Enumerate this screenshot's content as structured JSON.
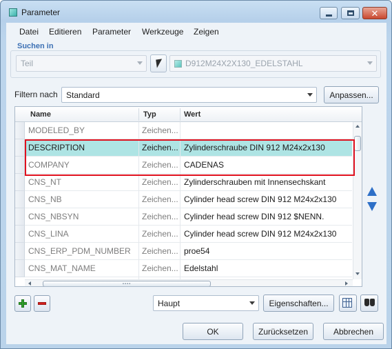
{
  "window": {
    "title": "Parameter",
    "controls": {
      "minimize": "minimize-icon",
      "maximize": "maximize-icon",
      "close": "close-icon"
    }
  },
  "menu": {
    "items": [
      {
        "label": "Datei"
      },
      {
        "label": "Editieren"
      },
      {
        "label": "Parameter"
      },
      {
        "label": "Werkzeuge"
      },
      {
        "label": "Zeigen"
      }
    ]
  },
  "search_in": {
    "legend": "Suchen in",
    "scope_value": "Teil",
    "part_value": "D912M24X2X130_EDELSTAHL"
  },
  "filter": {
    "label": "Filtern nach",
    "value": "Standard",
    "adjust_button": "Anpassen..."
  },
  "table": {
    "columns": {
      "name": "Name",
      "type": "Typ",
      "value": "Wert"
    },
    "rows": [
      {
        "name": "MODELED_BY",
        "type": "Zeichen...",
        "value": "",
        "selected": false
      },
      {
        "name": "DESCRIPTION",
        "type": "Zeichen...",
        "value": "Zylinderschraube DIN 912 M24x2x130",
        "selected": true
      },
      {
        "name": "COMPANY",
        "type": "Zeichen...",
        "value": "CADENAS",
        "selected": false
      },
      {
        "name": "CNS_NT",
        "type": "Zeichen...",
        "value": "Zylinderschrauben mit Innensechskant",
        "selected": false
      },
      {
        "name": "CNS_NB",
        "type": "Zeichen...",
        "value": "Cylinder head screw DIN 912 M24x2x130",
        "selected": false
      },
      {
        "name": "CNS_NBSYN",
        "type": "Zeichen...",
        "value": "Cylinder head screw DIN 912 $NENN.",
        "selected": false
      },
      {
        "name": "CNS_LINA",
        "type": "Zeichen...",
        "value": "Cylinder head screw DIN 912 M24x2x130",
        "selected": false
      },
      {
        "name": "CNS_ERP_PDM_NUMBER",
        "type": "Zeichen...",
        "value": "proe54",
        "selected": false
      },
      {
        "name": "CNS_MAT_NAME",
        "type": "Zeichen...",
        "value": "Edelstahl",
        "selected": false
      }
    ]
  },
  "bottom_bar": {
    "designation_value": "Haupt",
    "properties_button": "Eigenschaften..."
  },
  "footer": {
    "ok_button": "OK",
    "reset_button": "Zurücksetzen",
    "cancel_button": "Abbrechen"
  },
  "colors": {
    "selection": "#aee4e4",
    "highlight_border": "#e0101e",
    "legend_blue": "#3c70b4",
    "nav_arrow_blue": "#2d6fc7"
  }
}
